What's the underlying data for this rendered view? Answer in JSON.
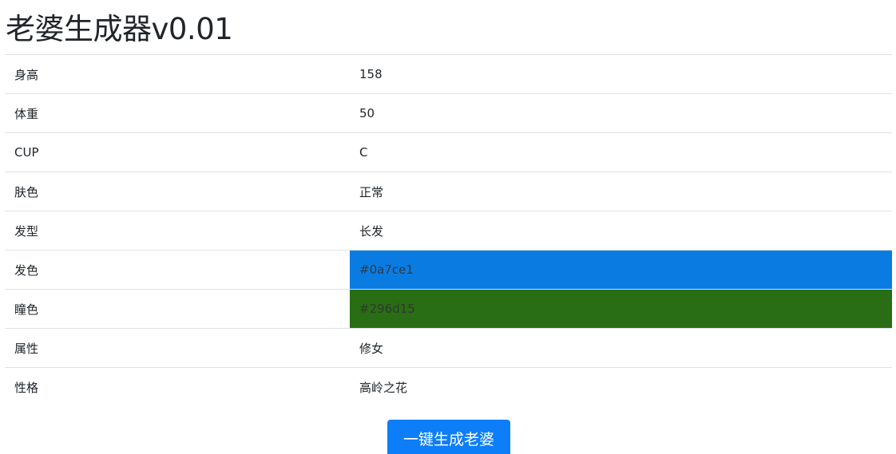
{
  "app": {
    "title": "老婆生成器v0.01"
  },
  "attributes": [
    {
      "label": "身高",
      "value": "158"
    },
    {
      "label": "体重",
      "value": "50"
    },
    {
      "label": "CUP",
      "value": "C"
    },
    {
      "label": "肤色",
      "value": "正常"
    },
    {
      "label": "发型",
      "value": "长发"
    },
    {
      "label": "发色",
      "value": "#0a7ce1"
    },
    {
      "label": "瞳色",
      "value": "#296d15"
    },
    {
      "label": "属性",
      "value": "修女"
    },
    {
      "label": "性格",
      "value": "高岭之花"
    }
  ],
  "colors": {
    "hair": "#0a7ce1",
    "eye": "#296d15",
    "button": "#0d7ef8"
  },
  "actions": {
    "generate_label": "一键生成老婆"
  }
}
